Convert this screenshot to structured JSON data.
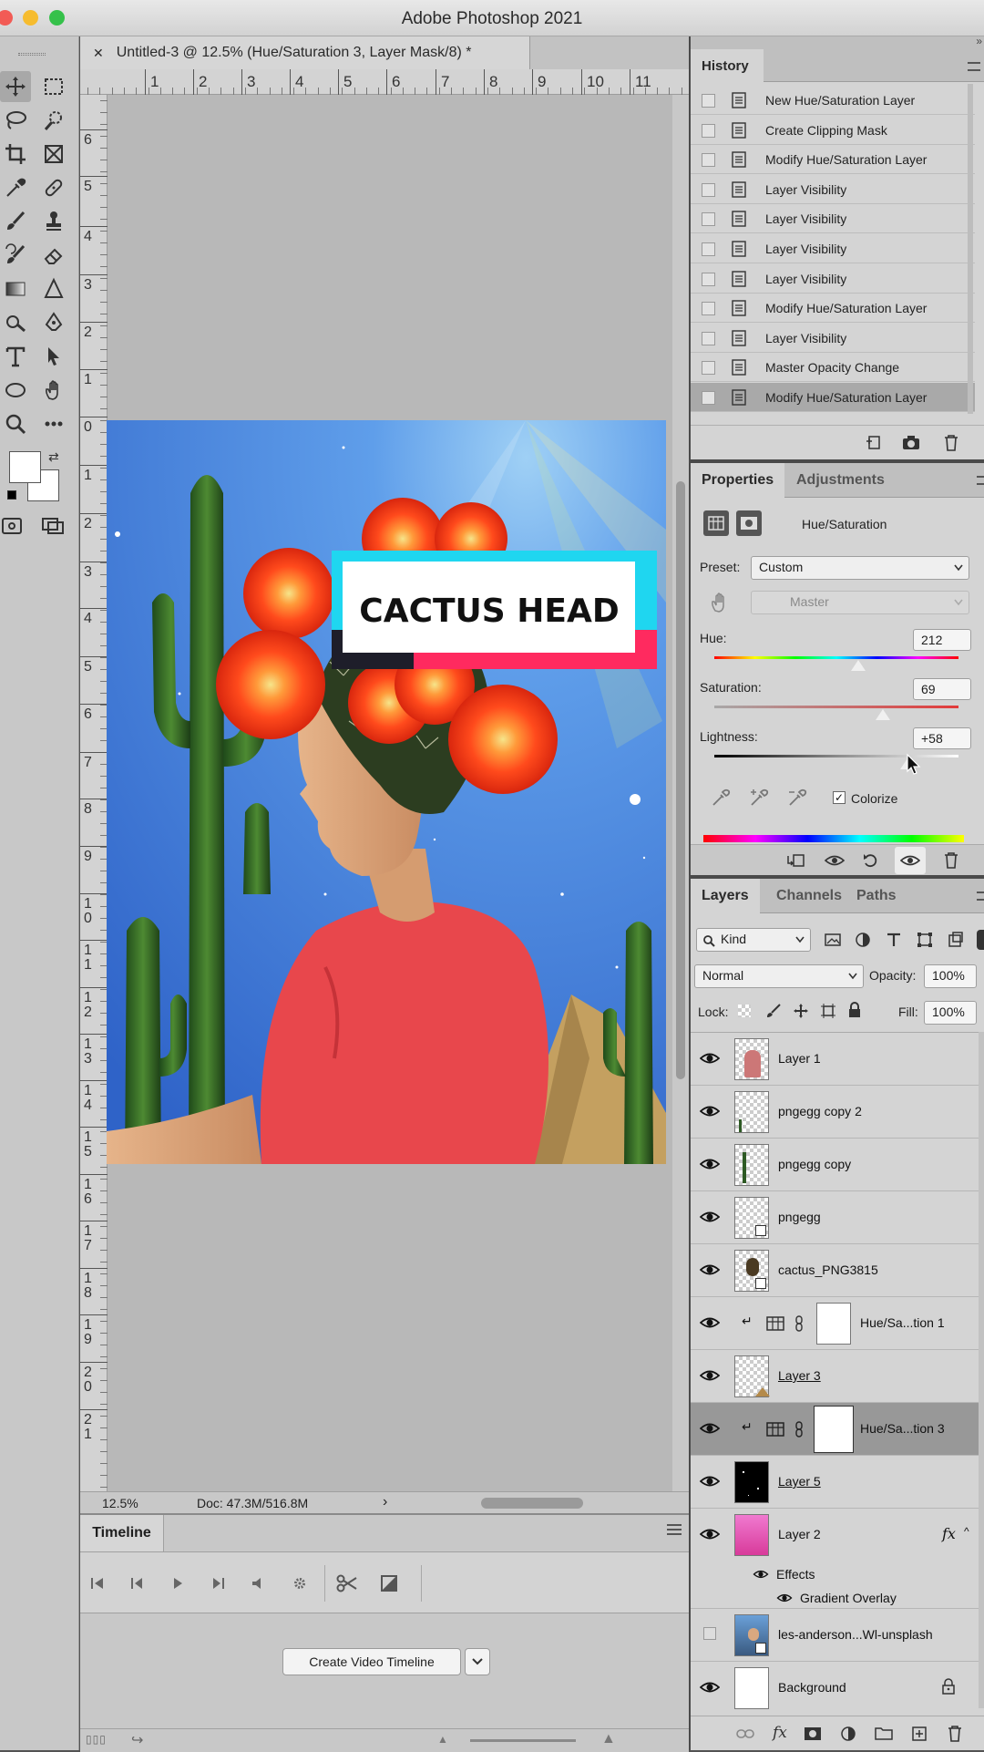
{
  "app": {
    "title": "Adobe Photoshop 2021"
  },
  "document": {
    "tab_title": "Untitled-3 @ 12.5% (Hue/Saturation 3, Layer Mask/8) *",
    "ruler_h": [
      "1",
      "2",
      "3",
      "4",
      "5",
      "6",
      "7",
      "8",
      "9",
      "10",
      "11"
    ],
    "ruler_v": [
      "6",
      "5",
      "4",
      "3",
      "2",
      "1",
      "0",
      "1",
      "2",
      "3",
      "4",
      "5",
      "6",
      "7",
      "8",
      "9",
      "1\n0",
      "1\n1",
      "1\n2",
      "1\n3",
      "1\n4",
      "1\n5",
      "1\n6",
      "1\n7",
      "1\n8",
      "1\n9",
      "2\n0",
      "2\n1"
    ],
    "artwork_text": "CACTUS HEAD"
  },
  "status": {
    "zoom": "12.5%",
    "doc_size": "Doc: 47.3M/516.8M",
    "arrow": "›"
  },
  "timeline": {
    "tab_label": "Timeline",
    "create_button": "Create Video Timeline"
  },
  "history": {
    "tab_label": "History",
    "items": [
      "New Hue/Saturation Layer",
      "Create Clipping Mask",
      "Modify Hue/Saturation Layer",
      "Layer Visibility",
      "Layer Visibility",
      "Layer Visibility",
      "Layer Visibility",
      "Modify Hue/Saturation Layer",
      "Layer Visibility",
      "Master Opacity Change",
      "Modify Hue/Saturation Layer"
    ],
    "selected_index": 10
  },
  "properties": {
    "tab_properties": "Properties",
    "tab_adjustments": "Adjustments",
    "adjustment_name": "Hue/Saturation",
    "preset_label": "Preset:",
    "preset_value": "Custom",
    "channel_value": "Master",
    "hue_label": "Hue:",
    "hue_value": "212",
    "hue_fraction": 0.59,
    "saturation_label": "Saturation:",
    "saturation_value": "69",
    "saturation_fraction": 0.69,
    "lightness_label": "Lightness:",
    "lightness_value": "+58",
    "lightness_fraction": 0.79,
    "colorize_label": "Colorize",
    "colorize_checked": true
  },
  "layers": {
    "tab_layers": "Layers",
    "tab_channels": "Channels",
    "tab_paths": "Paths",
    "filter_kind": "Kind",
    "blend_mode": "Normal",
    "opacity_label": "Opacity:",
    "opacity_value": "100%",
    "lock_label": "Lock:",
    "fill_label": "Fill:",
    "fill_value": "100%",
    "effects_label": "Effects",
    "gradient_overlay_label": "Gradient Overlay",
    "items": [
      {
        "name": "Layer 1"
      },
      {
        "name": "pngegg copy 2"
      },
      {
        "name": "pngegg copy"
      },
      {
        "name": "pngegg"
      },
      {
        "name": "cactus_PNG3815"
      },
      {
        "name": "Hue/Sa...tion 1"
      },
      {
        "name": "Layer 3"
      },
      {
        "name": "Hue/Sa...tion 3"
      },
      {
        "name": "Layer 5"
      },
      {
        "name": "Layer 2"
      },
      {
        "name": "les-anderson...Wl-unsplash"
      },
      {
        "name": "Background"
      }
    ]
  },
  "colors": {
    "accent_cyan": "#1fd6f0",
    "accent_pink": "#ff2a5f",
    "shirt_red": "#e8474c",
    "sky_blue": "#3d7de0"
  }
}
